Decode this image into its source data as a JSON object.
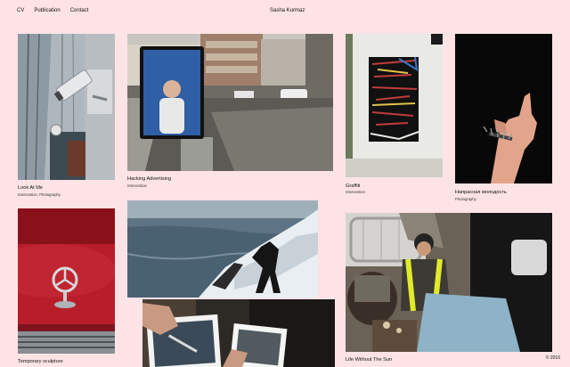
{
  "nav": {
    "cv": "CV",
    "publication": "Publication",
    "contact": "Contact"
  },
  "site_title": "Sasha Kurmaz",
  "works": [
    {
      "title": "Look At Me",
      "meta": "Intervention, Photography"
    },
    {
      "title": "Hacking Advertising",
      "meta": "Intervention"
    },
    {
      "title": "Graffiti",
      "meta": "Intervention"
    },
    {
      "title": "Напрасная молодость",
      "meta": "Photography"
    },
    {
      "title": "Temporary sculpture",
      "meta": ""
    },
    {
      "title": "Life Without The Sun",
      "meta": ""
    }
  ],
  "footer": {
    "copyright": "© 2016"
  }
}
